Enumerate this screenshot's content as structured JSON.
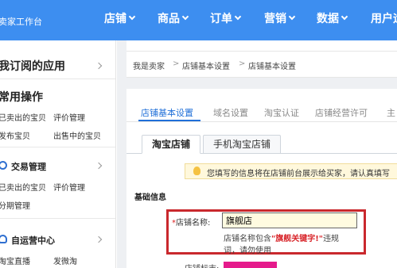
{
  "topbar": {
    "brand": "卖家工作台",
    "nav": [
      "店铺",
      "商品",
      "订单",
      "营销",
      "数据",
      "用户运"
    ]
  },
  "sidebar": {
    "subscribed_apps": "我订阅的应用",
    "common_ops": "常用操作",
    "common_links": [
      "已卖出的宝贝",
      "评价管理",
      "发布宝贝",
      "出售中的宝贝"
    ],
    "trade_mgmt": "交易管理",
    "trade_links": [
      "已卖出的宝贝",
      "评价管理",
      "分期管理"
    ],
    "self_op_center": "自运营中心",
    "self_op_links": [
      "淘宝直播",
      "发微淘"
    ]
  },
  "breadcrumb": [
    "我是卖家",
    "店铺基本设置",
    "店铺基本设置"
  ],
  "tabs": [
    "店铺基本设置",
    "域名设置",
    "淘宝认证",
    "店铺经营许可",
    "主"
  ],
  "subtabs": [
    "淘宝店铺",
    "手机淘宝店铺"
  ],
  "notice": "您填写的信息将在店铺前台展示给买家，请认真填写",
  "section_title": "基础信息",
  "form": {
    "required_mark": "*",
    "name_label": "店铺名称:",
    "name_value": "旗舰店",
    "hint_prefix": "店铺名称包含",
    "hint_keyword": "\"旗舰关键字!\"",
    "hint_suffix": "违规",
    "hint_line2": "词，请勿使用",
    "next_label": "店铺标志:"
  },
  "colors": {
    "topbar": "#3d8ef0",
    "accent": "#1f6fd8",
    "highlight_border": "#c9282d",
    "warning_text": "#d8262b",
    "logo_block": "#e51a8b"
  }
}
